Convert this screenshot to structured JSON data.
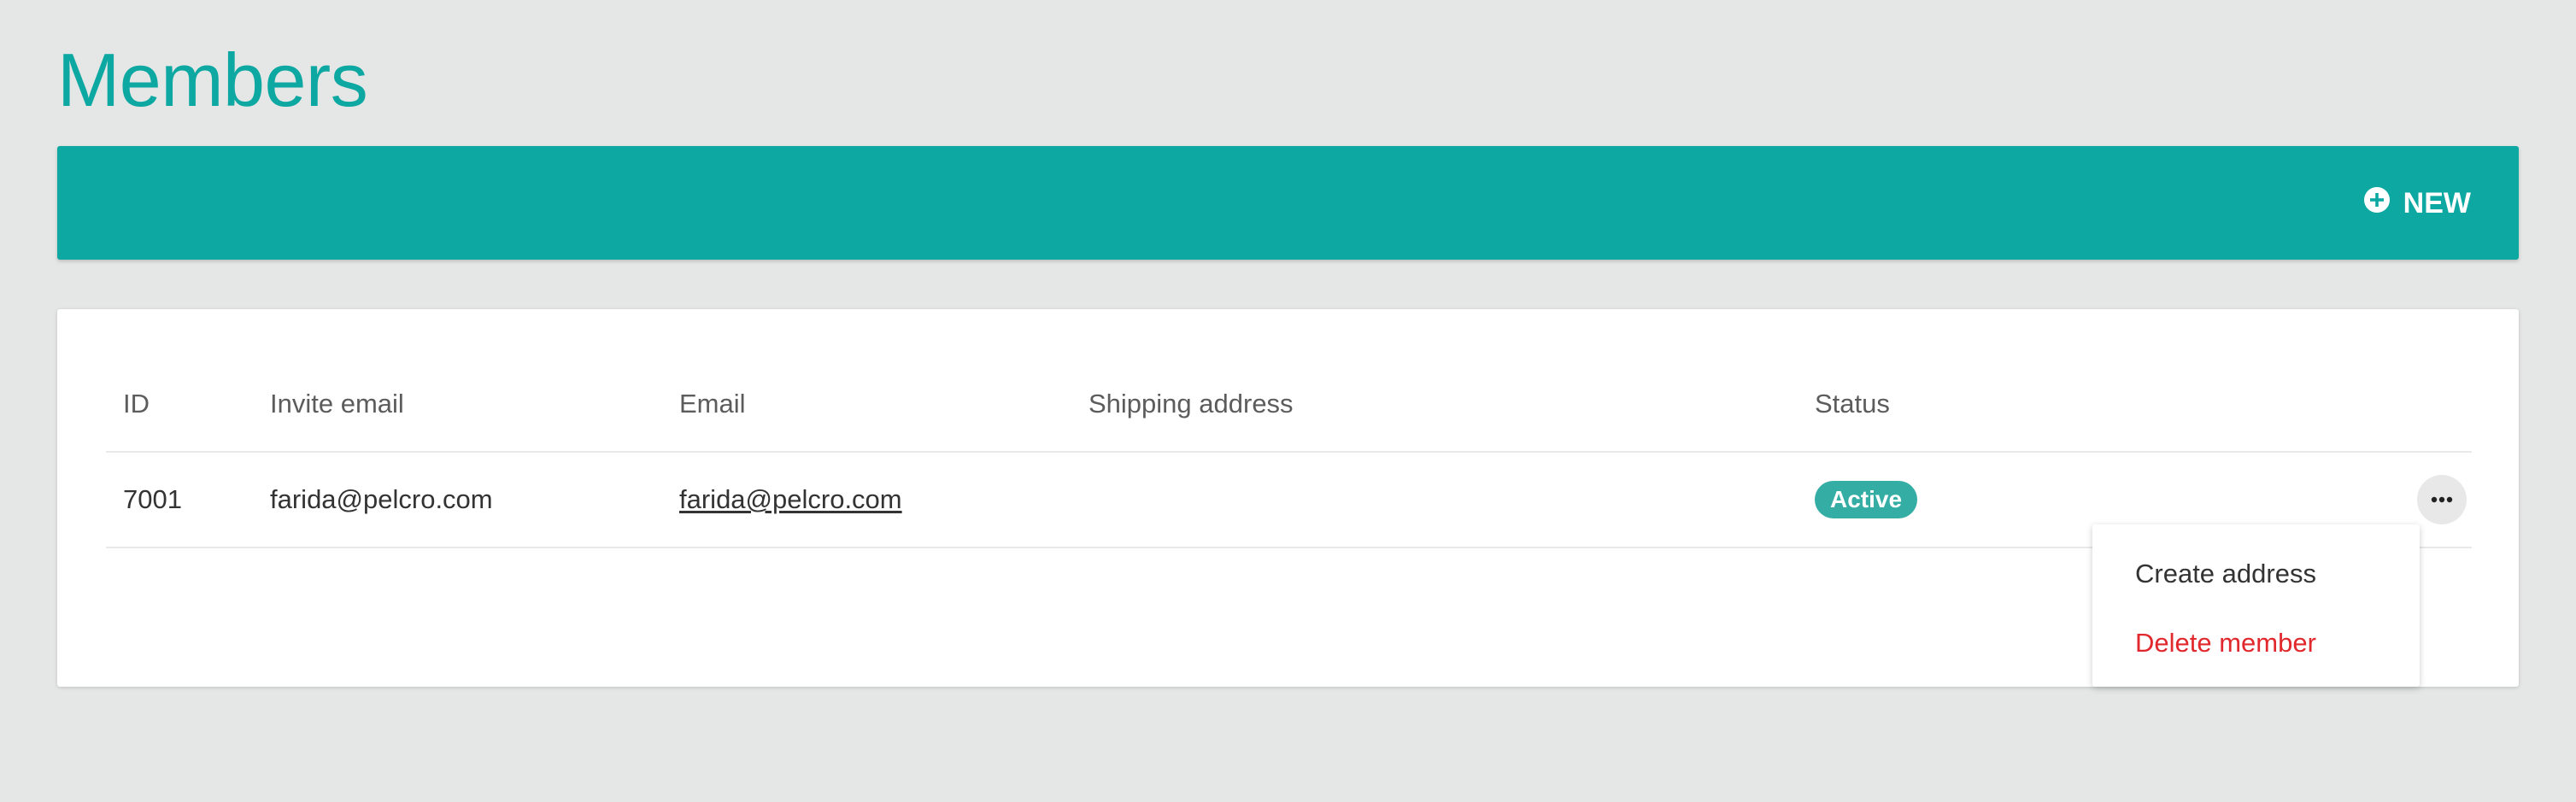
{
  "page": {
    "title": "Members"
  },
  "toolbar": {
    "new_label": "NEW",
    "new_icon": "plus-circle-icon"
  },
  "table": {
    "columns": [
      "ID",
      "Invite email",
      "Email",
      "Shipping address",
      "Status"
    ],
    "rows": [
      {
        "id": "7001",
        "invite_email": "farida@pelcro.com",
        "email": "farida@pelcro.com",
        "shipping_address": "",
        "status": "Active"
      }
    ]
  },
  "row_actions": {
    "icon": "more-horizontal-icon",
    "menu": [
      {
        "label": "Create address",
        "color": "#333333"
      },
      {
        "label": "Delete member",
        "color": "#e0282d"
      }
    ]
  },
  "colors": {
    "brand": "#0da8a1",
    "status_active": "#34aea5",
    "danger": "#e0282d",
    "background": "#e5e6e6"
  }
}
